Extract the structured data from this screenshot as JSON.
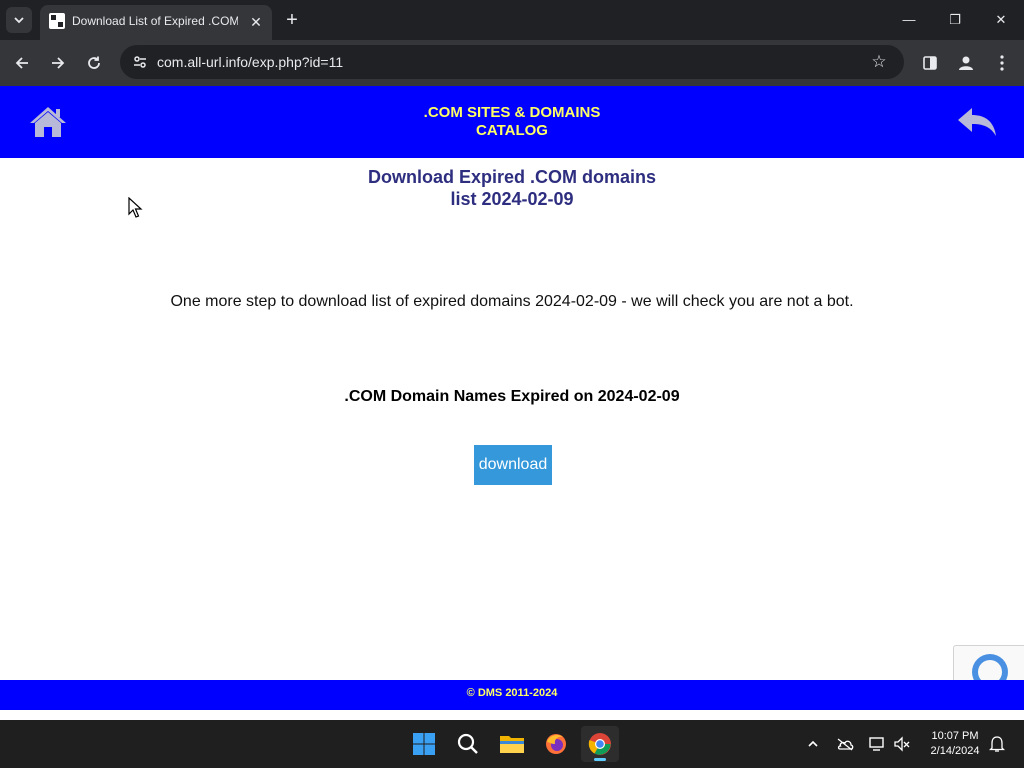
{
  "browser": {
    "tab_title": "Download List of Expired .COM domains",
    "tab_close": "✕",
    "new_tab": "+",
    "url": "com.all-url.info/exp.php?id=11",
    "window_controls": {
      "minimize": "—",
      "maximize": "❐",
      "close": "✕"
    }
  },
  "header": {
    "title_line1": ".COM SITES & DOMAINS",
    "title_line2": "CATALOG",
    "home_icon": "home-icon",
    "back_icon": "reply-arrow-icon"
  },
  "main": {
    "title_line1": "Download Expired .COM domains",
    "title_line2": "list 2024-02-09",
    "notice": "One more step to download list of expired domains 2024-02-09 - we will check you are not a bot.",
    "subheading": ".COM Domain Names Expired on 2024-02-09",
    "download_label": "download"
  },
  "footer": {
    "copyright": "© DMS 2011-2024"
  },
  "taskbar": {
    "time": "10:07 PM",
    "date": "2/14/2024"
  },
  "colors": {
    "header_bg": "#0000ff",
    "header_text": "#ffff66",
    "title_text": "#2e2e80",
    "button_bg": "#3498db"
  }
}
